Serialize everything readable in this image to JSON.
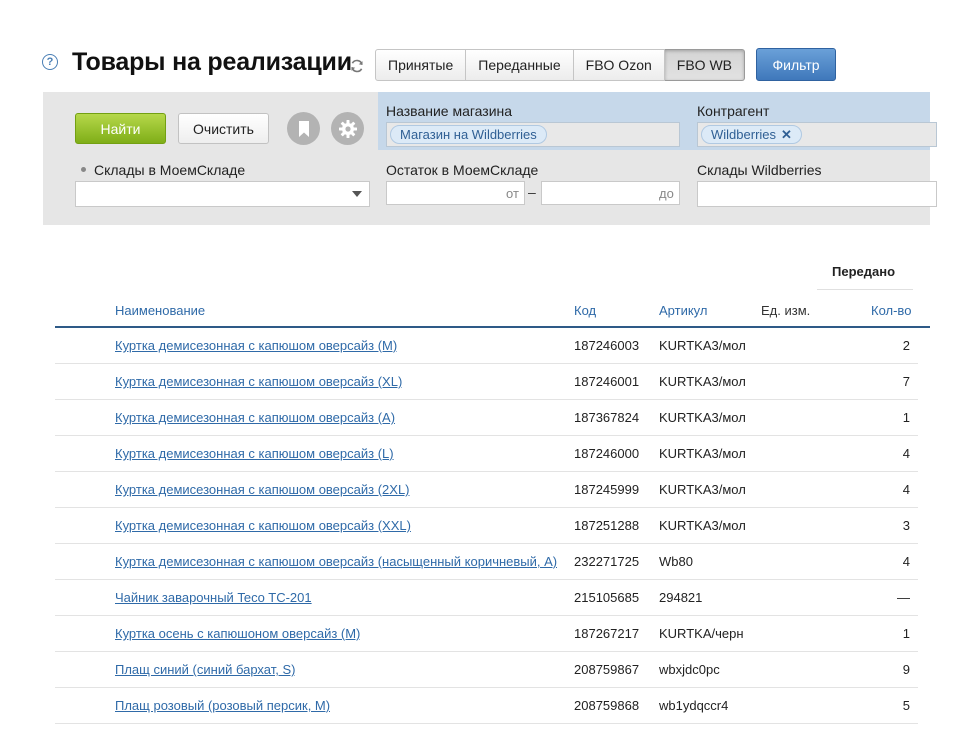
{
  "header": {
    "help_icon": "?",
    "title": "Товары на реализации",
    "tabs": [
      "Принятые",
      "Переданные",
      "FBO Ozon",
      "FBO WB"
    ],
    "active_tab": "FBO WB",
    "filter_button": "Фильтр"
  },
  "filters": {
    "find_button": "Найти",
    "clear_button": "Очистить",
    "store_name_label": "Название магазина",
    "store_name_tag": "Магазин на Wildberries",
    "counterparty_label": "Контрагент",
    "counterparty_tag": "Wildberries",
    "warehouses_label": "Склады в МоемСкладе",
    "stock_label": "Остаток в МоемСкладе",
    "stock_from_placeholder": "от",
    "stock_dash": "–",
    "stock_to_placeholder": "до",
    "wb_warehouses_label": "Склады Wildberries"
  },
  "table": {
    "group_header": "Передано",
    "columns": {
      "name": "Наименование",
      "code": "Код",
      "article": "Артикул",
      "unit": "Ед. изм.",
      "qty": "Кол-во"
    },
    "rows": [
      {
        "name": "Куртка демисезонная с капюшом оверсайз (M)",
        "code": "187246003",
        "article": "KURTKA3/мол",
        "qty": "2"
      },
      {
        "name": "Куртка демисезонная с капюшом оверсайз (XL)",
        "code": "187246001",
        "article": "KURTKA3/мол",
        "qty": "7"
      },
      {
        "name": "Куртка демисезонная с капюшом оверсайз (A)",
        "code": "187367824",
        "article": "KURTKA3/мол",
        "qty": "1"
      },
      {
        "name": "Куртка демисезонная с капюшом оверсайз (L)",
        "code": "187246000",
        "article": "KURTKA3/мол",
        "qty": "4"
      },
      {
        "name": "Куртка демисезонная с капюшом оверсайз (2XL)",
        "code": "187245999",
        "article": "KURTKA3/мол",
        "qty": "4"
      },
      {
        "name": "Куртка демисезонная с капюшом оверсайз (XXL)",
        "code": "187251288",
        "article": "KURTKA3/мол",
        "qty": "3"
      },
      {
        "name": "Куртка демисезонная с капюшом оверсайз (насыщенный коричневый, A)",
        "code": "232271725",
        "article": "Wb80",
        "qty": "4"
      },
      {
        "name": "Чайник заварочный Teco TC-201",
        "code": "215105685",
        "article": "294821",
        "qty": "—"
      },
      {
        "name": "Куртка осень с капюшоном оверсайз (M)",
        "code": "187267217",
        "article": "KURTKA/черн",
        "qty": "1"
      },
      {
        "name": "Плащ синий (синий бархат, S)",
        "code": "208759867",
        "article": "wbxjdc0pc",
        "qty": "9"
      },
      {
        "name": "Плащ розовый (розовый персик, M)",
        "code": "208759868",
        "article": "wb1ydqccr4",
        "qty": "5"
      }
    ]
  },
  "colors": {
    "accent_blue": "#3f78bb",
    "find_green": "#8ab820",
    "link_blue": "#2f6aa8"
  },
  "icons": {
    "help": "help-circle-icon",
    "refresh": "refresh-icon",
    "bookmark": "bookmark-icon",
    "settings": "gear-icon",
    "remove_tag": "close-icon",
    "dropdown": "chevron-down-icon"
  }
}
